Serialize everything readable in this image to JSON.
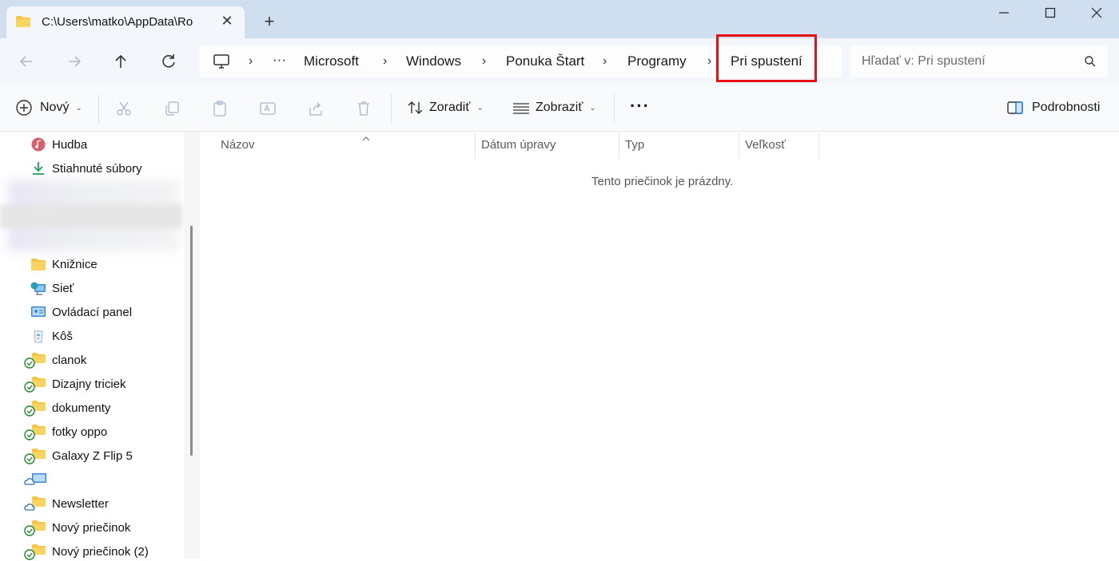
{
  "window": {
    "tab_title": "C:\\Users\\matko\\AppData\\Ro",
    "tab_close": "✕",
    "new_tab": "+",
    "minimize": "—",
    "close": "✕"
  },
  "address": {
    "ellipsis": "···",
    "crumbs": [
      "Microsoft",
      "Windows",
      "Ponuka Štart",
      "Programy",
      "Pri spustení"
    ],
    "separator": "›",
    "search_placeholder": "Hľadať v: Pri spustení"
  },
  "toolbar": {
    "new_label": "Nový",
    "sort_label": "Zoradiť",
    "view_label": "Zobraziť",
    "more_label": "···",
    "details_label": "Podrobnosti",
    "caret": "⌄"
  },
  "sidebar": {
    "items": [
      {
        "label": "Hudba",
        "icon": "music-icon"
      },
      {
        "label": "Stiahnuté súbory",
        "icon": "download-icon"
      },
      {
        "label": "Knižnice",
        "icon": "folder-icon"
      },
      {
        "label": "Sieť",
        "icon": "network-icon"
      },
      {
        "label": "Ovládací panel",
        "icon": "control-panel-icon"
      },
      {
        "label": "Kôš",
        "icon": "recycle-bin-icon"
      },
      {
        "label": "clanok",
        "icon": "synced-folder-icon"
      },
      {
        "label": "Dizajny triciek",
        "icon": "synced-folder-icon"
      },
      {
        "label": "dokumenty",
        "icon": "synced-folder-icon"
      },
      {
        "label": "fotky oppo",
        "icon": "synced-folder-icon"
      },
      {
        "label": "Galaxy Z Flip 5",
        "icon": "synced-folder-icon"
      },
      {
        "label": "",
        "icon": "cloud-control-panel-icon"
      },
      {
        "label": "Newsletter",
        "icon": "cloud-folder-icon"
      },
      {
        "label": "Nový priečinok",
        "icon": "synced-folder-icon"
      },
      {
        "label": "Nový priečinok (2)",
        "icon": "synced-folder-icon"
      }
    ]
  },
  "columns": {
    "name": "Názov",
    "modified": "Dátum úpravy",
    "type": "Typ",
    "size": "Veľkosť"
  },
  "main": {
    "empty_message": "Tento priečinok je prázdny."
  },
  "colors": {
    "highlight": "#e81010",
    "titlebar": "#cfdff0",
    "folder": "#f6c544",
    "sync_green": "#1a8a2a",
    "accent": "#0067c0"
  }
}
